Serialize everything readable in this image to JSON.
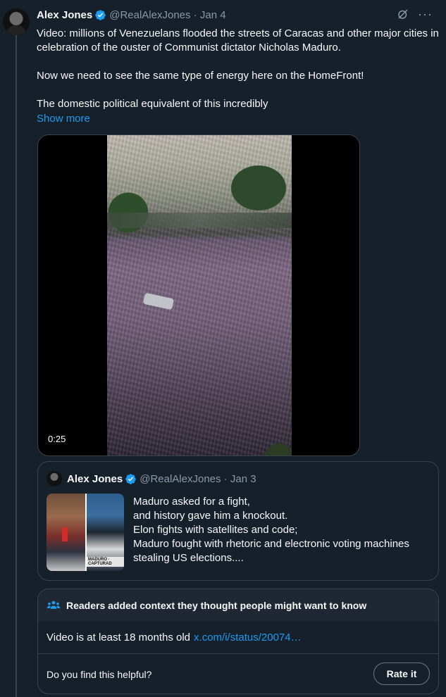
{
  "tweet": {
    "author_name": "Alex Jones",
    "handle": "@RealAlexJones",
    "separator": " · ",
    "date": "Jan 4",
    "more_icon": "more-icon",
    "grok_icon": "grok-icon",
    "paragraphs": [
      "Video: millions of Venezuelans flooded the streets of Caracas and other major cities in celebration of the ouster of Communist dictator Nicholas Maduro.",
      "Now we need to see the same type of energy here on the HomeFront!",
      "The domestic political equivalent of this incredibly"
    ],
    "show_more": "Show more",
    "video": {
      "duration": "0:25"
    }
  },
  "quote": {
    "author_name": "Alex Jones",
    "handle": "@RealAlexJones",
    "separator": " · ",
    "date": "Jan 3",
    "thumbnail_caption": "MADURO · CAPTURAD",
    "lines": [
      "Maduro asked for a fight,",
      "and history gave him a knockout.",
      "Elon fights with satellites and code;",
      "Maduro fought with rhetoric and electronic voting machines",
      "stealing US elections...."
    ]
  },
  "community_note": {
    "heading": "Readers added context they thought people might want to know",
    "body": "Video is at least 18 months old",
    "link": "x.com/i/status/20074…",
    "question": "Do you find this helpful?",
    "rate_label": "Rate it"
  },
  "colors": {
    "background": "#15202b",
    "link": "#1d9bf0",
    "verified": "#1d9bf0",
    "secondary_text": "#8b98a5"
  }
}
